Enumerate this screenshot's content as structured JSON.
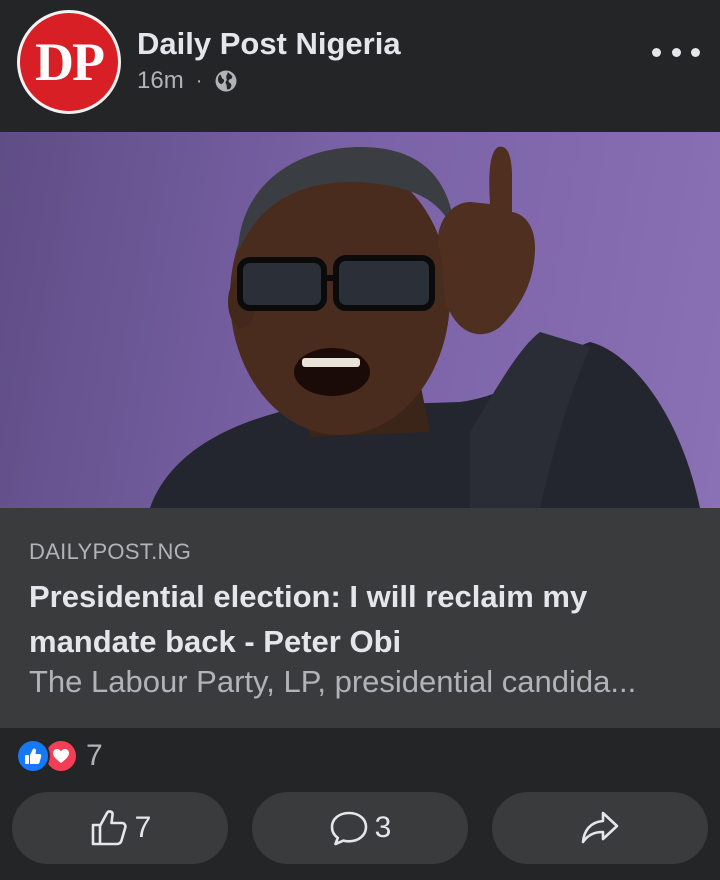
{
  "post": {
    "avatar_text": "DP",
    "page_name": "Daily Post Nigeria",
    "time": "16m",
    "separator": "·",
    "privacy_icon": "globe-icon",
    "more_icon": "more-horizontal-icon"
  },
  "link_preview": {
    "domain": "DAILYPOST.NG",
    "headline": "Presidential election: I will reclaim my mandate back - Peter Obi",
    "excerpt": "The Labour Party, LP, presidential candida..."
  },
  "reactions": {
    "icons": [
      "like-reaction-icon",
      "love-reaction-icon"
    ],
    "count": "7"
  },
  "actions": {
    "like_count": "7",
    "comment_count": "3",
    "like_icon": "thumbs-up-icon",
    "comment_icon": "comment-icon",
    "share_icon": "share-icon"
  },
  "colors": {
    "background": "#242526",
    "surface": "#3a3b3c",
    "text_primary": "#e4e6eb",
    "text_secondary": "#b0b3b8",
    "brand_red": "#d81f26",
    "like_blue": "#1877f2",
    "love_red": "#f33e58"
  }
}
